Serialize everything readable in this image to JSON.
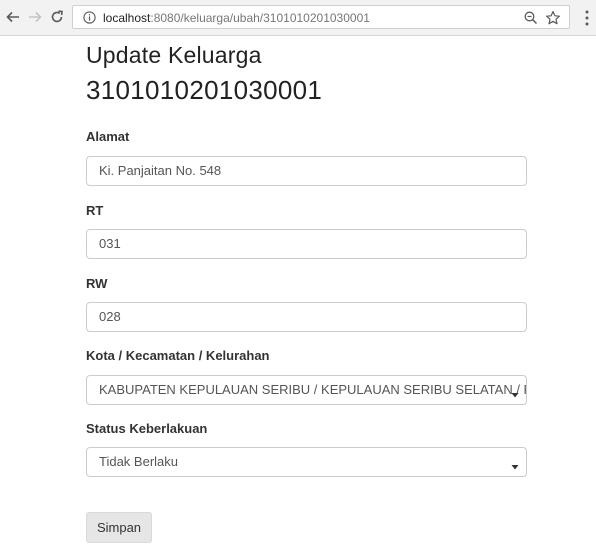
{
  "browser": {
    "url_host": "localhost",
    "url_rest": ":8080/keluarga/ubah/3101010201030001"
  },
  "page": {
    "title": "Update Keluarga",
    "subtitle": "3101010201030001"
  },
  "form": {
    "alamat": {
      "label": "Alamat",
      "value": "Ki. Panjaitan No. 548"
    },
    "rt": {
      "label": "RT",
      "value": "031"
    },
    "rw": {
      "label": "RW",
      "value": "028"
    },
    "lokasi": {
      "label": "Kota / Kecamatan / Kelurahan",
      "selected": "KABUPATEN KEPULAUAN SERIBU / KEPULAUAN SERIBU SELATAN / PULAU UNTUNG JAWA"
    },
    "status": {
      "label": "Status Keberlakuan",
      "selected": "Tidak Berlaku"
    },
    "submit_label": "Simpan"
  },
  "colors": {
    "chrome": "#f2f2f2",
    "border": "#cccccc",
    "button": "#e6e6e6"
  },
  "icons": [
    "back-arrow-icon",
    "forward-arrow-icon",
    "reload-icon",
    "info-icon",
    "zoom-icon",
    "star-icon",
    "menu-dots-icon",
    "caret-down-icon"
  ]
}
